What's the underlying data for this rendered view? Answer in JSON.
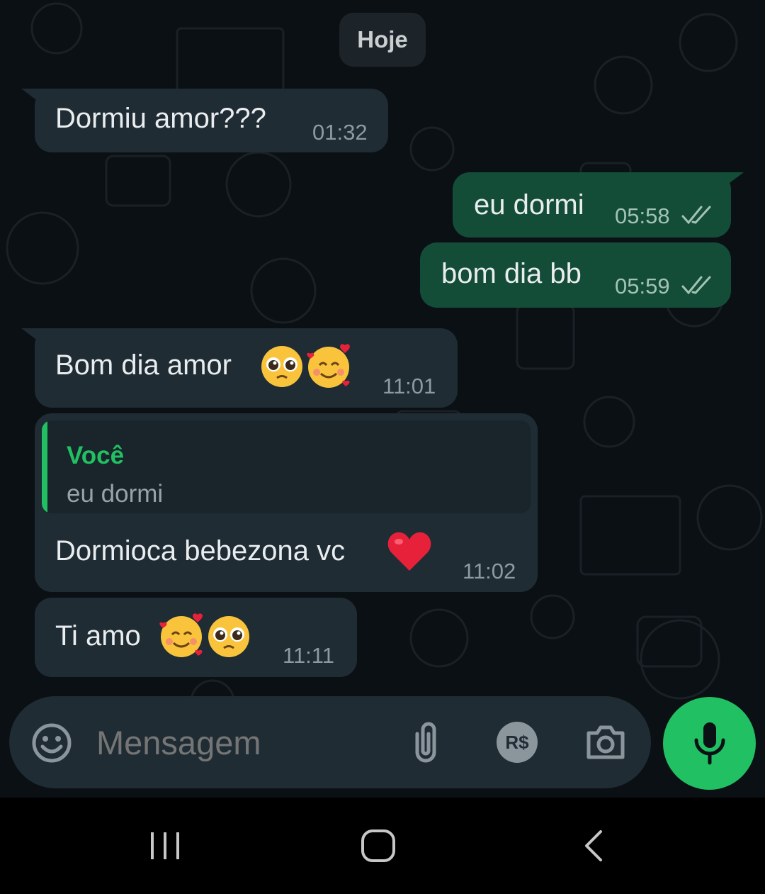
{
  "date_separator": "Hoje",
  "messages": [
    {
      "direction": "incoming",
      "text": "Dormiu amor???",
      "time": "01:32"
    },
    {
      "direction": "outgoing",
      "text": "eu dormi",
      "time": "05:58",
      "status": "read-double-check-icon"
    },
    {
      "direction": "outgoing",
      "text": "bom dia bb",
      "time": "05:59",
      "status": "read-double-check-icon"
    },
    {
      "direction": "incoming",
      "text": "Bom dia amor",
      "emojis": [
        "pleading-face-emoji",
        "smiling-face-with-hearts-emoji"
      ],
      "time": "11:01"
    },
    {
      "direction": "incoming",
      "reply": {
        "author": "Você",
        "text": "eu dormi"
      },
      "text": "Dormioca bebezona vc",
      "emojis": [
        "red-heart-emoji"
      ],
      "time": "11:02"
    },
    {
      "direction": "incoming",
      "text": "Ti amo",
      "emojis": [
        "smiling-face-with-hearts-emoji",
        "pleading-face-emoji"
      ],
      "time": "11:11"
    }
  ],
  "composer": {
    "placeholder": "Mensagem",
    "icons": [
      "emoji-icon",
      "attach-icon",
      "payment-icon",
      "camera-icon",
      "mic-icon"
    ],
    "payment_label": "R$"
  },
  "navbar": {
    "icons": [
      "recent-apps-icon",
      "home-icon",
      "back-icon"
    ]
  },
  "colors": {
    "background": "#0b1014",
    "incoming_bubble": "#1f2c34",
    "outgoing_bubble": "#144d37",
    "accent": "#21c063",
    "text": "#e9edef",
    "timestamp": "#8c9aa2"
  }
}
